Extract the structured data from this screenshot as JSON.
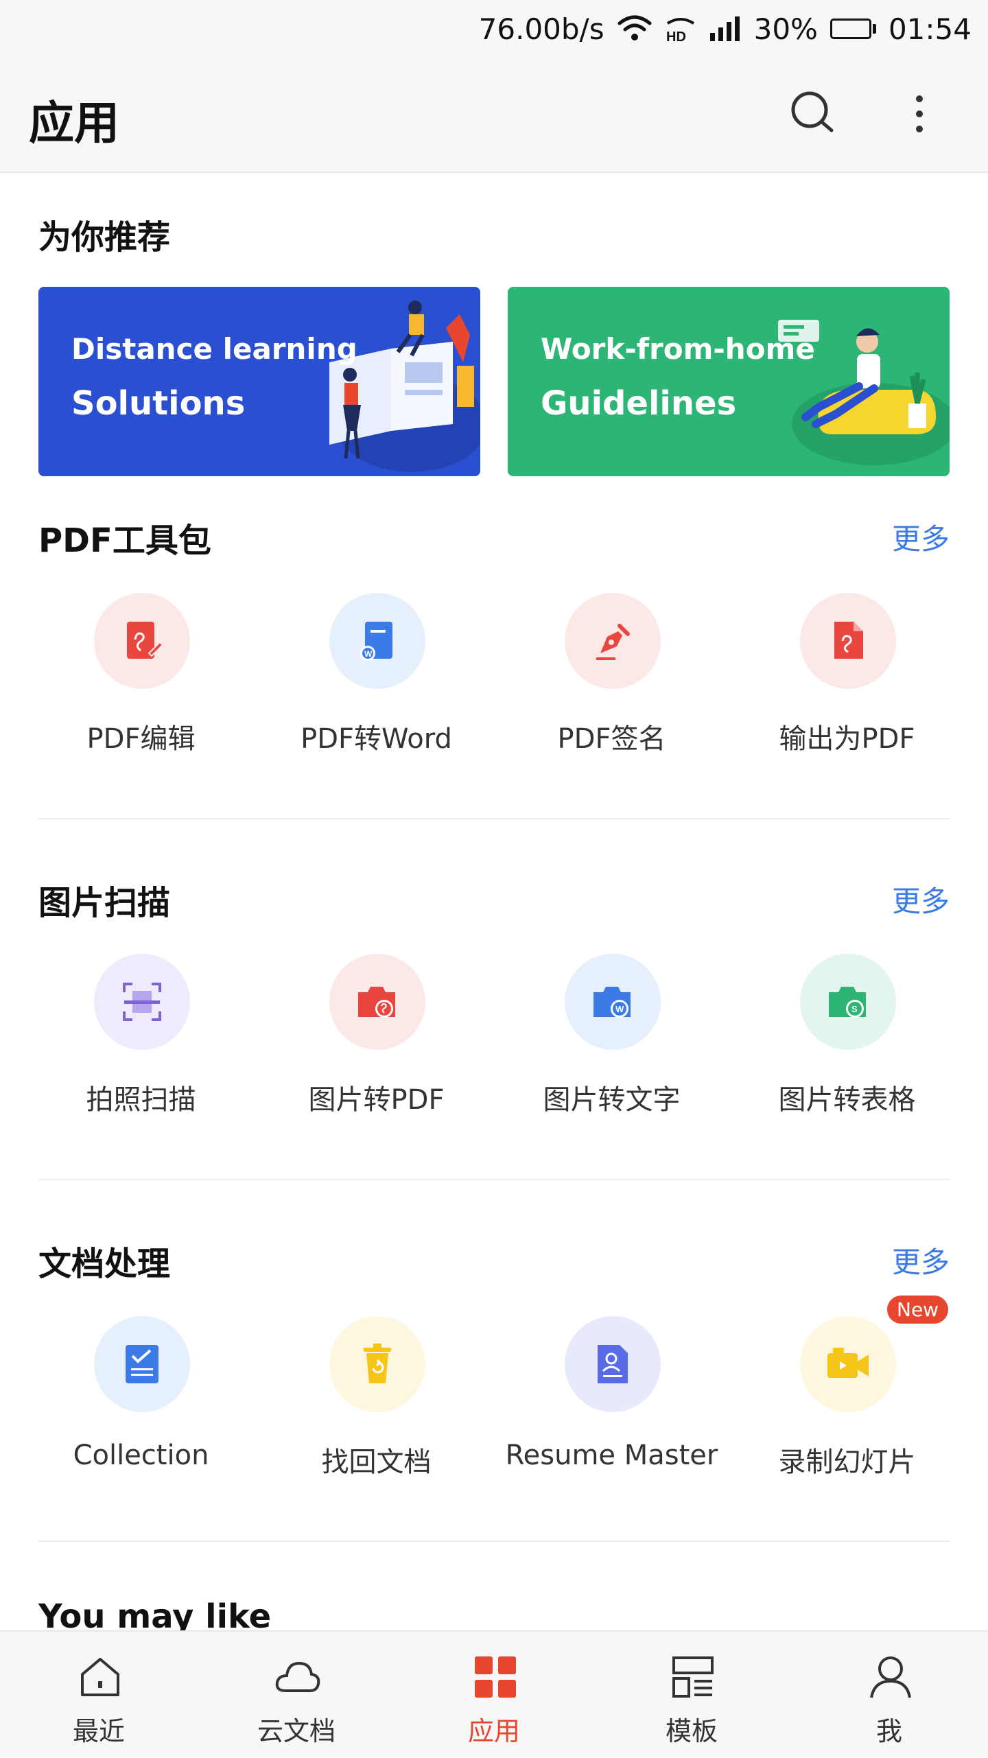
{
  "status_bar": {
    "speed": "76.00b/s",
    "battery": "30%",
    "battery_level": 0.3,
    "time": "01:54",
    "icons": [
      "wifi-icon",
      "hd-icon",
      "signal-icon",
      "battery-icon"
    ]
  },
  "header": {
    "title": "应用",
    "icons": [
      "search-icon",
      "more-vertical-icon"
    ]
  },
  "recommend": {
    "title": "为你推荐",
    "banners": [
      {
        "line1": "Distance learning",
        "line2": "Solutions",
        "color": "#2a4fd0"
      },
      {
        "line1": "Work-from-home",
        "line2": "Guidelines",
        "color": "#2cb574"
      }
    ]
  },
  "pdf_tools": {
    "title": "PDF工具包",
    "more": "更多",
    "items": [
      {
        "label": "PDF编辑",
        "icon": "pdf-edit-icon"
      },
      {
        "label": "PDF转Word",
        "icon": "pdf-to-word-icon"
      },
      {
        "label": "PDF签名",
        "icon": "pdf-sign-icon"
      },
      {
        "label": "输出为PDF",
        "icon": "export-pdf-icon"
      }
    ]
  },
  "scan": {
    "title": "图片扫描",
    "more": "更多",
    "items": [
      {
        "label": "拍照扫描",
        "icon": "photo-scan-icon"
      },
      {
        "label": "图片转PDF",
        "icon": "image-to-pdf-icon"
      },
      {
        "label": "图片转文字",
        "icon": "image-to-text-icon"
      },
      {
        "label": "图片转表格",
        "icon": "image-to-sheet-icon"
      }
    ]
  },
  "docs": {
    "title": "文档处理",
    "more": "更多",
    "items": [
      {
        "label": "Collection",
        "icon": "collection-icon"
      },
      {
        "label": "找回文档",
        "icon": "recover-doc-icon"
      },
      {
        "label": "Resume Master",
        "icon": "resume-icon"
      },
      {
        "label": "录制幻灯片",
        "icon": "record-slides-icon",
        "badge": "New"
      }
    ]
  },
  "you_may_like": {
    "title": "You may like"
  },
  "bottom_nav": {
    "items": [
      {
        "label": "最近",
        "icon": "home-icon"
      },
      {
        "label": "云文档",
        "icon": "cloud-icon"
      },
      {
        "label": "应用",
        "icon": "apps-grid-icon",
        "active": true
      },
      {
        "label": "模板",
        "icon": "template-icon"
      },
      {
        "label": "我",
        "icon": "user-icon"
      }
    ]
  }
}
